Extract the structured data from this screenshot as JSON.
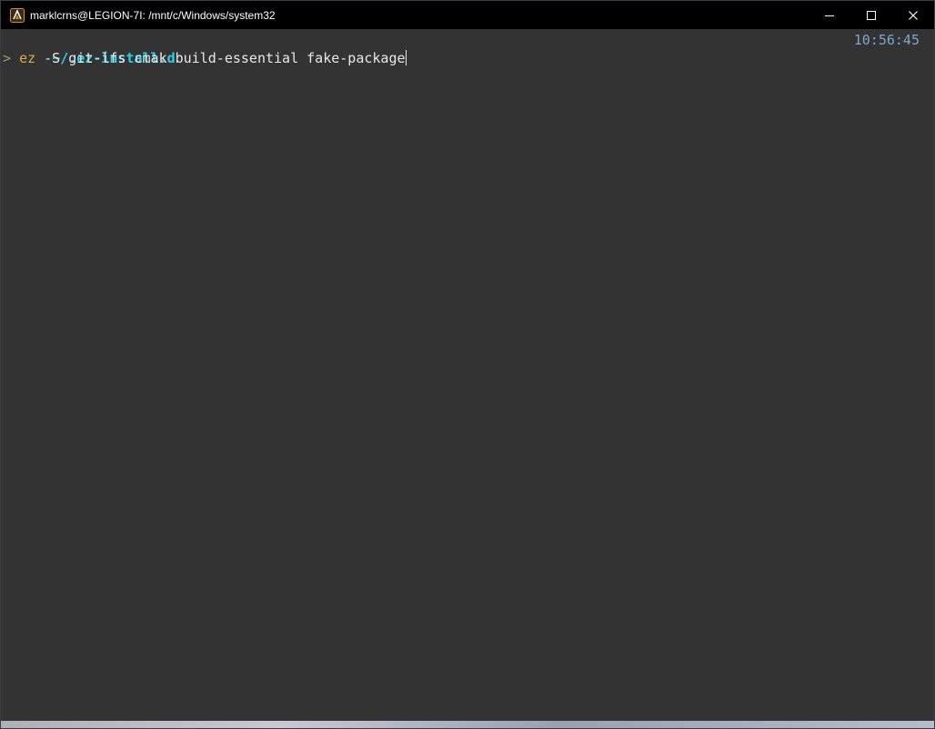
{
  "window": {
    "title": "marklcrns@LEGION-7I: /mnt/c/Windows/system32",
    "app_icon": "terminal-app-icon",
    "controls": {
      "minimize_icon": "minimize-icon",
      "maximize_icon": "maximize-icon",
      "close_icon": "close-icon"
    }
  },
  "terminal": {
    "cwd": "~/.ez-install.d",
    "clock": "10:56:45",
    "prompt_char": ">",
    "command": "ez",
    "args": " -S git-lfs cmak build-essential fake-package"
  },
  "colors": {
    "background": "#333333",
    "titlebar": "#000000",
    "cwd": "#2ad2ee",
    "clock": "#7ea6c8",
    "prompt": "#a39a64",
    "command": "#e0a84a",
    "text": "#e8e8e8"
  }
}
